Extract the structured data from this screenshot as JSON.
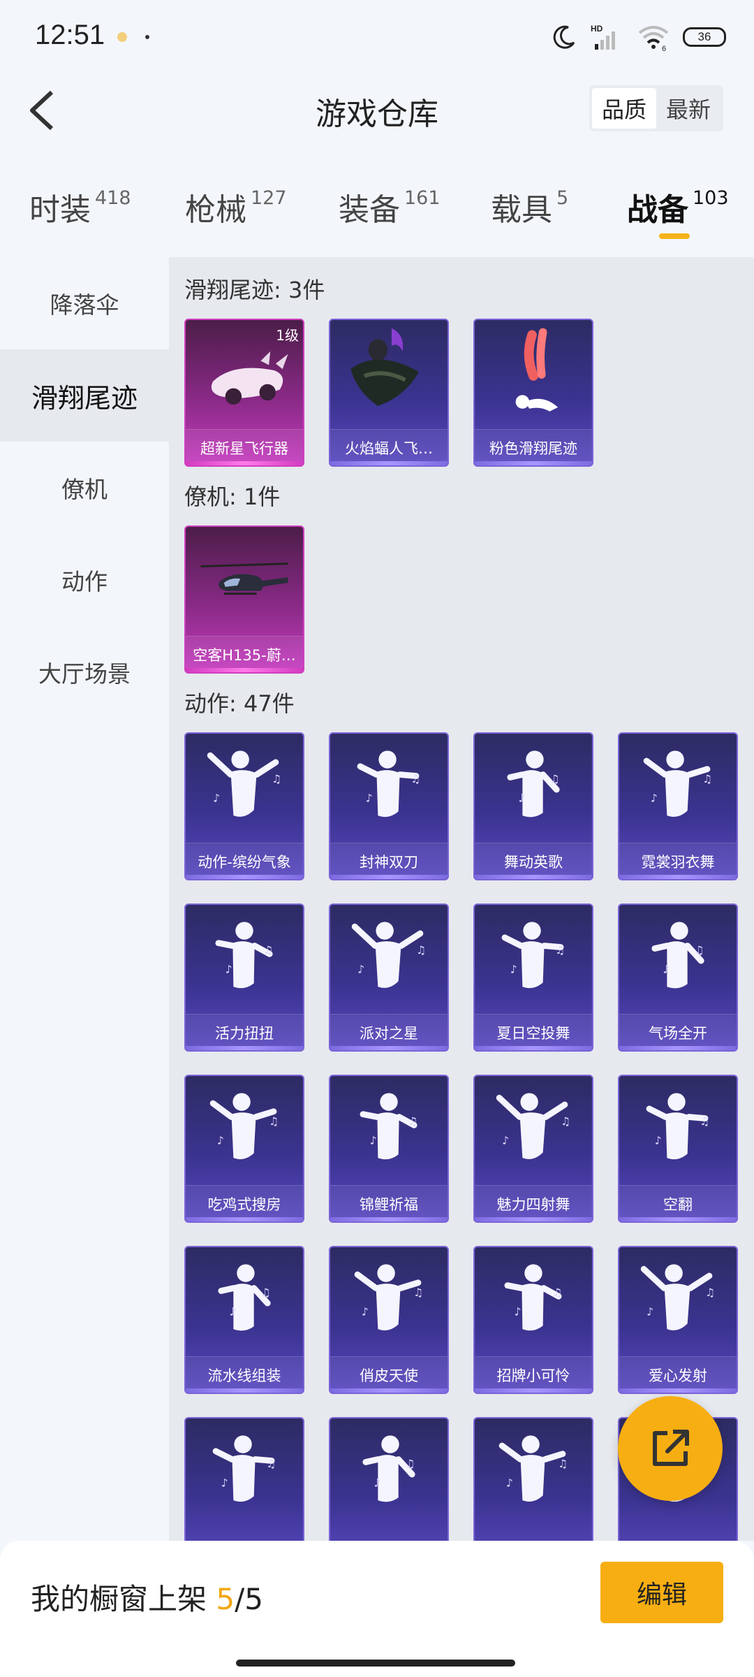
{
  "status_bar": {
    "time": "12:51",
    "battery": "36",
    "icons": [
      "moon-icon",
      "hd-signal-icon",
      "wifi-icon",
      "battery-icon"
    ]
  },
  "header": {
    "title": "游戏仓库",
    "sort_options": [
      "品质",
      "最新"
    ],
    "active_sort": "品质"
  },
  "tabs": [
    {
      "label": "时装",
      "count": "418"
    },
    {
      "label": "枪械",
      "count": "127"
    },
    {
      "label": "装备",
      "count": "161"
    },
    {
      "label": "载具",
      "count": "5"
    },
    {
      "label": "战备",
      "count": "103"
    }
  ],
  "active_tab": "战备",
  "sidebar": {
    "items": [
      {
        "label": "降落伞"
      },
      {
        "label": "滑翔尾迹"
      },
      {
        "label": "僚机"
      },
      {
        "label": "动作"
      },
      {
        "label": "大厅场景"
      }
    ],
    "active": "滑翔尾迹"
  },
  "sections": [
    {
      "title": "滑翔尾迹: 3件",
      "items": [
        {
          "name": "超新星飞行器",
          "badge": "1级",
          "rarity": "pink"
        },
        {
          "name": "火焰蝠人飞…",
          "rarity": "purple"
        },
        {
          "name": "粉色滑翔尾迹",
          "rarity": "purple"
        }
      ]
    },
    {
      "title": "僚机: 1件",
      "items": [
        {
          "name": "空客H135-蔚…",
          "rarity": "pink"
        }
      ]
    },
    {
      "title": "动作: 47件",
      "items": [
        {
          "name": "动作-缤纷气象"
        },
        {
          "name": "封神双刀"
        },
        {
          "name": "舞动英歌"
        },
        {
          "name": "霓裳羽衣舞"
        },
        {
          "name": "活力扭扭"
        },
        {
          "name": "派对之星"
        },
        {
          "name": "夏日空投舞"
        },
        {
          "name": "气场全开"
        },
        {
          "name": "吃鸡式搜房"
        },
        {
          "name": "锦鲤祈福"
        },
        {
          "name": "魅力四射舞"
        },
        {
          "name": "空翻"
        },
        {
          "name": "流水线组装"
        },
        {
          "name": "俏皮天使"
        },
        {
          "name": "招牌小可怜"
        },
        {
          "name": "爱心发射"
        }
      ]
    }
  ],
  "bottom_bar": {
    "label": "我的橱窗上架",
    "used": "5",
    "total": "/5",
    "edit_label": "编辑"
  },
  "colors": {
    "accent": "#f7ae12",
    "purple_rarity": "#7b63d7",
    "pink_rarity": "#d03fbf"
  }
}
